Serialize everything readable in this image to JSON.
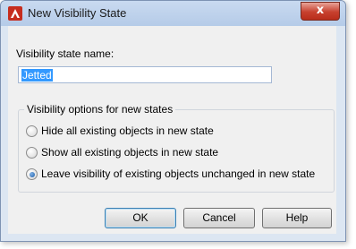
{
  "window": {
    "title": "New Visibility State",
    "close_label": "x",
    "app_icon": "autocad-a-icon",
    "accent_color": "#c62d1e"
  },
  "form": {
    "name_label": "Visibility state name:",
    "name_value": "Jetted"
  },
  "options": {
    "group_title": "Visibility options for new states",
    "items": [
      {
        "label": "Hide all existing objects in new state",
        "checked": false
      },
      {
        "label": "Show all existing objects in new state",
        "checked": false
      },
      {
        "label": "Leave visibility of existing objects unchanged in new state",
        "checked": true
      }
    ]
  },
  "buttons": {
    "ok": "OK",
    "cancel": "Cancel",
    "help": "Help"
  }
}
